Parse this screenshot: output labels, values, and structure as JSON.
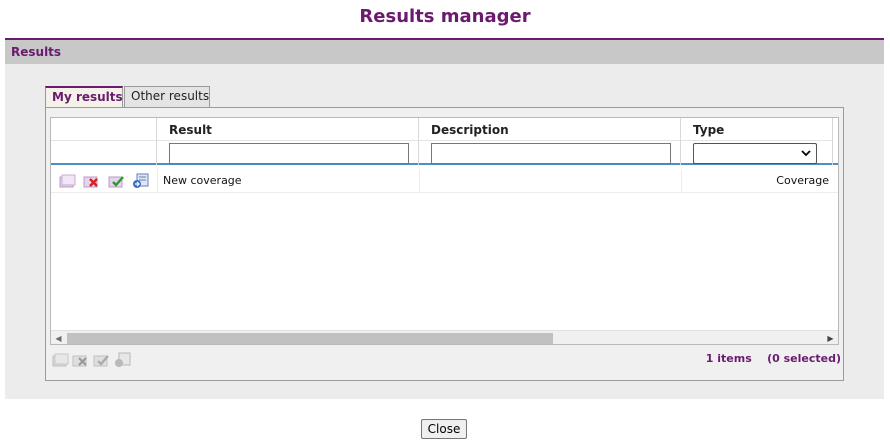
{
  "page": {
    "title": "Results manager"
  },
  "panel": {
    "header": "Results"
  },
  "tabs": [
    {
      "label": "My results",
      "active": true
    },
    {
      "label": "Other results",
      "active": false
    }
  ],
  "grid": {
    "columns": [
      {
        "key": "actions",
        "label": ""
      },
      {
        "key": "result",
        "label": "Result",
        "filter": ""
      },
      {
        "key": "description",
        "label": "Description",
        "filter": ""
      },
      {
        "key": "type",
        "label": "Type",
        "filter": ""
      }
    ],
    "rows": [
      {
        "actions": [
          "open-icon",
          "delete-icon",
          "apply-icon",
          "export-icon"
        ],
        "result": "New coverage",
        "description": "",
        "type": "Coverage"
      }
    ]
  },
  "toolbar": {
    "icons": [
      "open-icon",
      "delete-icon",
      "apply-icon",
      "export-icon"
    ]
  },
  "status": {
    "items": "1 items",
    "selected": "(0 selected)"
  },
  "footer": {
    "close_label": "Close"
  },
  "colors": {
    "accent": "#6a1b6f",
    "header_underline": "#4a90c2"
  }
}
